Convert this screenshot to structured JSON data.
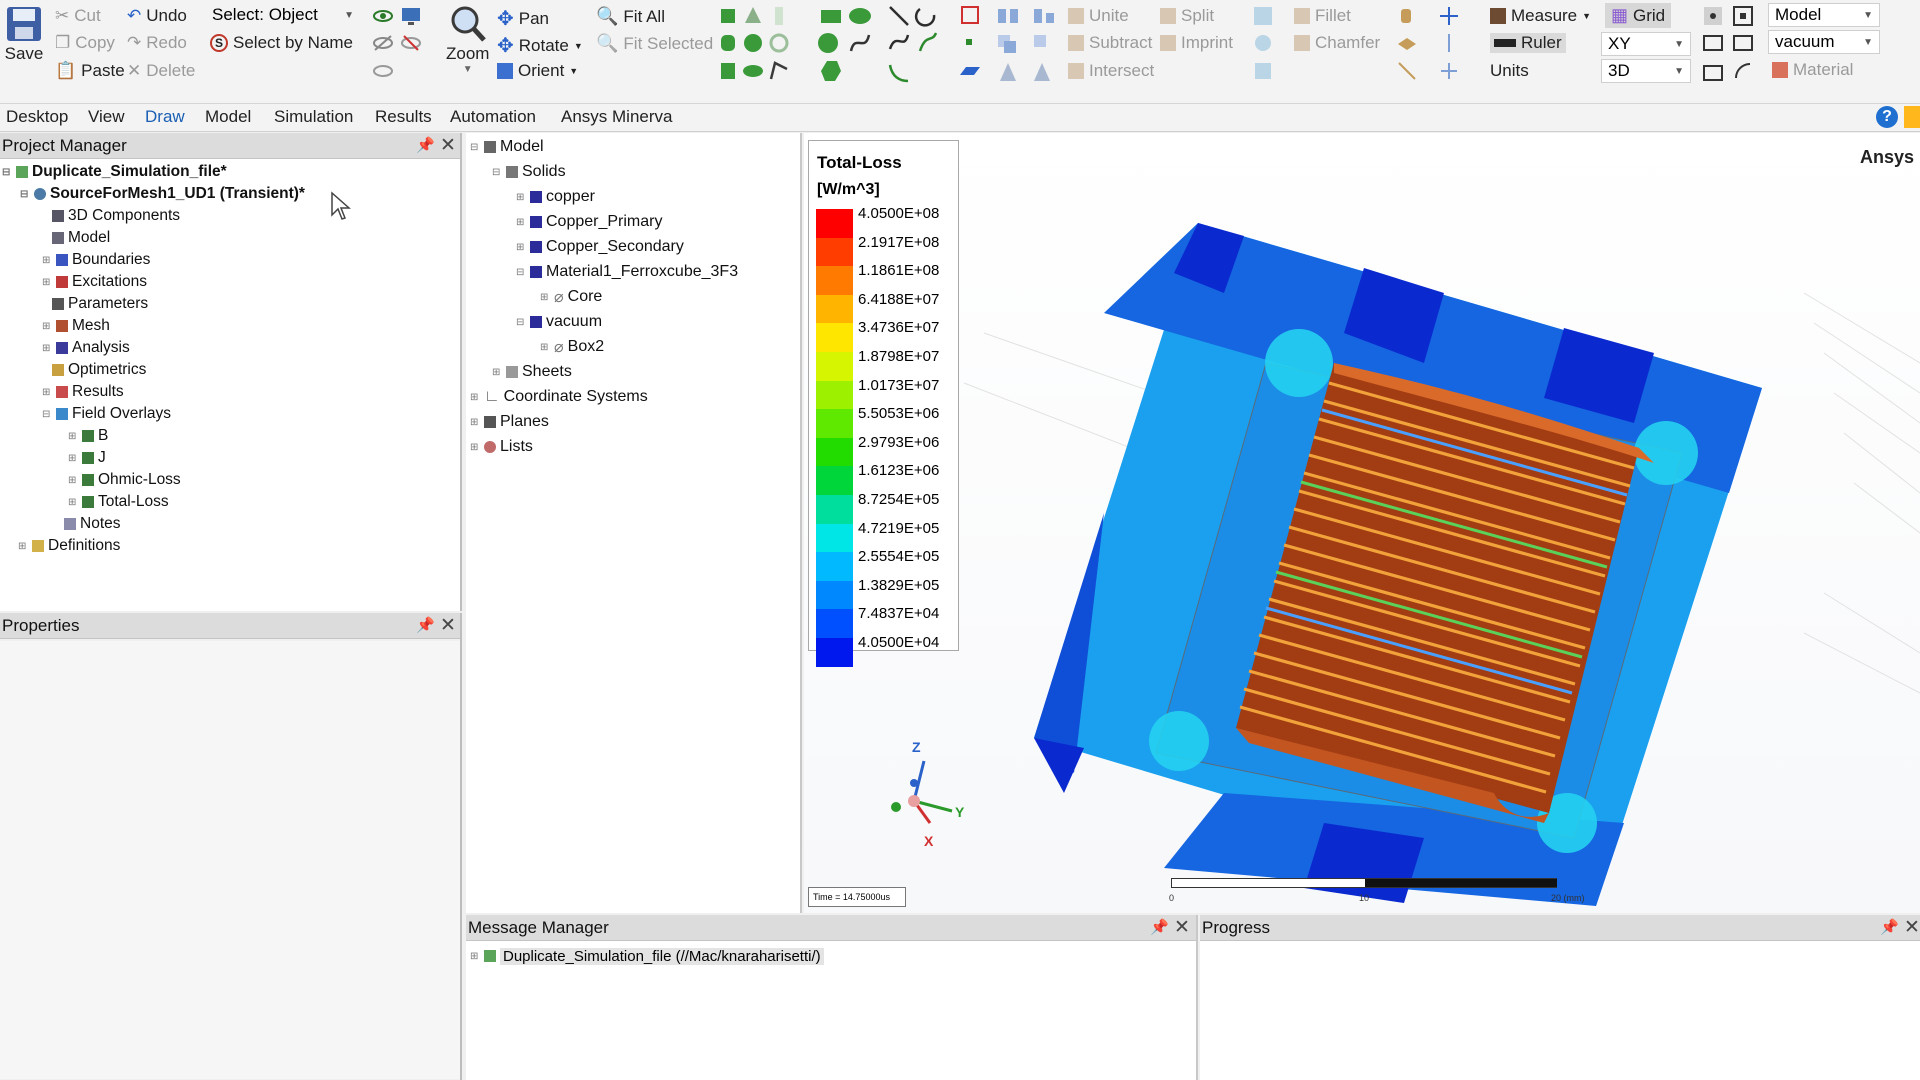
{
  "ribbon": {
    "save": "Save",
    "cut": "Cut",
    "copy": "Copy",
    "paste": "Paste",
    "undo": "Undo",
    "redo": "Redo",
    "delete": "Delete",
    "select_label": "Select: Object",
    "select_by_name": "Select by Name",
    "zoom": "Zoom",
    "pan": "Pan",
    "rotate": "Rotate",
    "orient": "Orient",
    "fit_all": "Fit All",
    "fit_selected": "Fit Selected",
    "unite": "Unite",
    "subtract": "Subtract",
    "intersect": "Intersect",
    "split": "Split",
    "imprint": "Imprint",
    "fillet": "Fillet",
    "chamfer": "Chamfer",
    "measure": "Measure",
    "ruler": "Ruler",
    "units": "Units",
    "grid": "Grid",
    "plane_value": "XY",
    "dim_value": "3D",
    "model_value": "Model",
    "material_value": "vacuum",
    "material_btn": "Material"
  },
  "menu": [
    "Desktop",
    "View",
    "Draw",
    "Model",
    "Simulation",
    "Results",
    "Automation",
    "Ansys Minerva"
  ],
  "menu_active": "Draw",
  "project_manager": {
    "title": "Project Manager",
    "project": "Duplicate_Simulation_file*",
    "design": "SourceForMesh1_UD1 (Transient)*",
    "items": [
      "3D Components",
      "Model",
      "Boundaries",
      "Excitations",
      "Parameters",
      "Mesh",
      "Analysis",
      "Optimetrics",
      "Results",
      "Field Overlays"
    ],
    "overlays": [
      "B",
      "J",
      "Ohmic-Loss",
      "Total-Loss"
    ],
    "notes": "Notes",
    "definitions": "Definitions"
  },
  "properties": {
    "title": "Properties"
  },
  "model_tree": {
    "root": "Model",
    "solids": "Solids",
    "items": [
      "copper",
      "Copper_Primary",
      "Copper_Secondary",
      "Material1_Ferroxcube_3F3"
    ],
    "core": "Core",
    "vacuum": "vacuum",
    "box2": "Box2",
    "sheets": "Sheets",
    "coordinate_systems": "Coordinate Systems",
    "planes": "Planes",
    "lists": "Lists"
  },
  "viewport": {
    "brand": "Ansys",
    "time_label": "Time = 14.75000us",
    "scale_labels": [
      "0",
      "10",
      "20 (mm)"
    ],
    "axes": {
      "z": "Z",
      "y": "Y",
      "x": "X"
    }
  },
  "legend": {
    "title": "Total-Loss",
    "unit": "[W/m^3]",
    "values": [
      "4.0500E+08",
      "2.1917E+08",
      "1.1861E+08",
      "6.4188E+07",
      "3.4736E+07",
      "1.8798E+07",
      "1.0173E+07",
      "5.5053E+06",
      "2.9793E+06",
      "1.6123E+06",
      "8.7254E+05",
      "4.7219E+05",
      "2.5554E+05",
      "1.3829E+05",
      "7.4837E+04",
      "4.0500E+04"
    ],
    "colors": [
      "#ff0000",
      "#ff3d00",
      "#ff7a00",
      "#ffb400",
      "#ffe600",
      "#d6f500",
      "#9cf000",
      "#5fe800",
      "#22dc00",
      "#00d53a",
      "#00de9e",
      "#00e6e6",
      "#00b9ff",
      "#0089ff",
      "#0050ff",
      "#0018ee"
    ]
  },
  "message_manager": {
    "title": "Message Manager",
    "entry": "Duplicate_Simulation_file (//Mac/knaraharisetti/)"
  },
  "progress": {
    "title": "Progress"
  }
}
